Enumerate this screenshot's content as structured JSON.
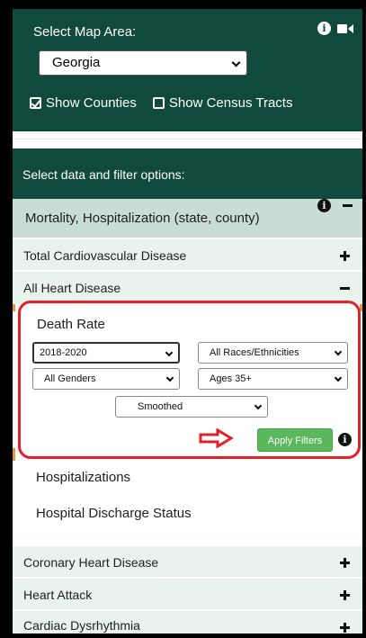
{
  "map_area": {
    "title": "Select Map Area:",
    "state_value": "Georgia",
    "show_counties_label": "Show Counties",
    "show_counties_checked": true,
    "show_tracts_label": "Show Census Tracts",
    "show_tracts_checked": false
  },
  "filters": {
    "header": "Select data and filter options:",
    "category": "Mortality, Hospitalization (state, county)",
    "topics": [
      {
        "label": "Total Cardiovascular Disease",
        "expanded": false
      },
      {
        "label": "All Heart Disease",
        "expanded": true
      },
      {
        "label": "Coronary Heart Disease",
        "expanded": false
      },
      {
        "label": "Heart Attack",
        "expanded": false
      },
      {
        "label": "Cardiac Dysrhythmia",
        "expanded": false
      }
    ],
    "death_rate": {
      "title": "Death Rate",
      "year": "2018-2020",
      "race": "All Races/Ethnicities",
      "gender": "All Genders",
      "age": "Ages 35+",
      "smoothing": "Smoothed",
      "apply_label": "Apply Filters"
    },
    "sub_items": [
      "Hospitalizations",
      "Hospital Discharge Status"
    ]
  },
  "colors": {
    "dark_green": "#104a3c",
    "row_green": "#c9ddd4",
    "light_green": "#e9f3ee",
    "button_green": "#5cb85c",
    "highlight_red": "#e2202a"
  }
}
